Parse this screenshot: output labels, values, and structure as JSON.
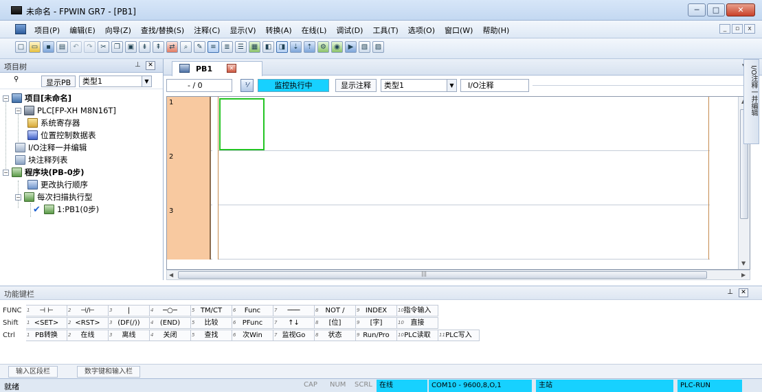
{
  "window": {
    "title": "未命名 - FPWIN GR7 - [PB1]",
    "controls": [
      "─",
      "□",
      "✕"
    ]
  },
  "menubar": {
    "items": [
      "项目(P)",
      "编辑(E)",
      "向导(Z)",
      "查找/替换(S)",
      "注释(C)",
      "显示(V)",
      "转换(A)",
      "在线(L)",
      "调试(D)",
      "工具(T)",
      "选项(O)",
      "窗口(W)",
      "帮助(H)"
    ],
    "mdi_controls": [
      "_",
      "▫",
      "x"
    ]
  },
  "project_tree": {
    "title": "项目树",
    "show_pb_label": "显示PB",
    "type_value": "类型1",
    "items": [
      {
        "label": "项目[未命名]",
        "bold": true
      },
      {
        "label": "PLC[FP-XH M8N16T]"
      },
      {
        "label": "系统寄存器"
      },
      {
        "label": "位置控制数据表"
      },
      {
        "label": "I/O注释一并编辑"
      },
      {
        "label": "块注释列表"
      },
      {
        "label": "程序块(PB-0步)",
        "bold": true
      },
      {
        "label": "更改执行顺序"
      },
      {
        "label": "每次扫描执行型"
      },
      {
        "label": "1:PB1(0步)"
      }
    ]
  },
  "document": {
    "tab_label": "PB1",
    "step_value": "- / 0",
    "monitor_status": "监控执行中",
    "show_comment_label": "显示注释",
    "type_value": "类型1",
    "io_comment_label": "I/O注释",
    "rung_numbers": [
      "1",
      "2",
      "3"
    ],
    "monitor_color": "#17d1ff",
    "rung_number_color": "#f8c9a0",
    "cursor_color": "#22c422"
  },
  "side_tab": {
    "label": "I/O注释一并编辑"
  },
  "function_keys": {
    "title": "功能键栏",
    "rows": [
      {
        "label": "FUNC",
        "keys": [
          "⊣ ⊢",
          "⊣/⊢",
          "|",
          "─○─",
          "TM/CT",
          "Func",
          "───",
          "NOT /",
          "INDEX",
          "指令输入"
        ]
      },
      {
        "label": "Shift",
        "keys": [
          "<SET>",
          "<RST>",
          "(DF(/))",
          "(END)",
          "比较",
          "PFunc",
          "↑↓",
          "[位]",
          "[字]",
          "直接"
        ]
      },
      {
        "label": "Ctrl",
        "keys": [
          "PB转换",
          "在线",
          "离线",
          "关闭",
          "查找",
          "次Win",
          "监视Go",
          "状态",
          "Run/Pro",
          "PLC读取",
          "PLC写入"
        ]
      }
    ],
    "key_numbers": [
      "1",
      "2",
      "3",
      "4",
      "5",
      "6",
      "7",
      "8",
      "9",
      "10",
      "11"
    ]
  },
  "bottom_tabs": [
    "输入区段栏",
    "数字键和输入栏"
  ],
  "statusbar": {
    "ready": "就绪",
    "cap": "CAP",
    "num": "NUM",
    "scrl": "SCRL",
    "online": "在线",
    "comm": "COM10 - 9600,8,O,1",
    "station": "主站",
    "plc_mode": "PLC-RUN"
  }
}
